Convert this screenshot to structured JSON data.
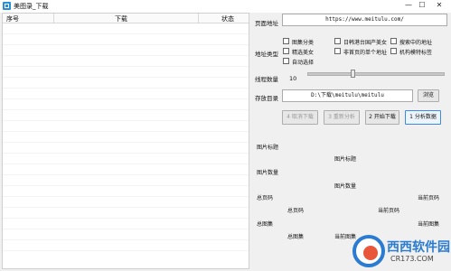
{
  "window": {
    "title": "美图录_下载",
    "min": "—",
    "max": "☐",
    "close": "✕"
  },
  "list": {
    "columns": [
      "序号",
      "下载",
      "状态"
    ]
  },
  "form": {
    "page_url_label": "页面地址",
    "page_url_value": "https://www.meitulu.com/",
    "type_label": "地址类型",
    "types": [
      {
        "label": "图集分类"
      },
      {
        "label": "日韩港台国产美女"
      },
      {
        "label": "搜索中的地址"
      },
      {
        "label": "精选美女"
      },
      {
        "label": "非首页的单个地址"
      },
      {
        "label": "机构模特标签"
      },
      {
        "label": "自动选择"
      }
    ],
    "threads_label": "线程数量",
    "threads_value": "10",
    "threads_level": 0.33,
    "dir_label": "存放目录",
    "dir_value": "D:\\下载\\meitulu\\meitulu",
    "browse": "浏览",
    "buttons": {
      "cancel": "4 取消下载",
      "reanalyze": "3 重新分析",
      "start": "2 开始下载",
      "analyze": "1 分析数据"
    }
  },
  "info": {
    "pic_title_label": "图片标题",
    "pic_title_value": "图片标题",
    "pic_count_label": "图片数量",
    "pic_count_value": "图片数量",
    "total_pages_label": "总页码",
    "current_page_right": "当前页码",
    "total_pages_value": "总页码",
    "current_page_right2": "当前页码",
    "total_albums_label": "总图集",
    "current_album_right": "当前图集",
    "total_albums_value": "总图集",
    "current_album_mid": "当前图集"
  },
  "watermark": {
    "brand": "西西软件园",
    "domain": "CR173.COM"
  }
}
